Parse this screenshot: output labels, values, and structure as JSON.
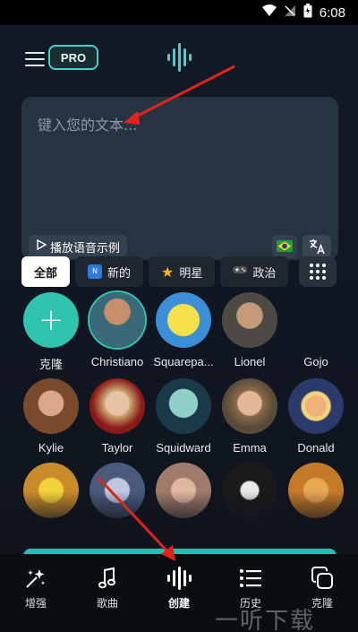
{
  "status_bar": {
    "time": "6:08"
  },
  "header": {
    "pro_label": "PRO"
  },
  "text_input": {
    "placeholder": "键入您的文本...",
    "sample_button": "播放语音示例"
  },
  "categories": [
    {
      "label": "全部",
      "active": true,
      "icon": ""
    },
    {
      "label": "新的",
      "active": false,
      "icon": "new-badge-icon"
    },
    {
      "label": "明星",
      "active": false,
      "icon": "star-icon"
    },
    {
      "label": "政治",
      "active": false,
      "icon": "game-controller-icon"
    }
  ],
  "voices": [
    {
      "name": "克隆",
      "type": "add"
    },
    {
      "name": "Christiano",
      "color": "#3a6a7a"
    },
    {
      "name": "Squarepa...",
      "color": "#f2d43a"
    },
    {
      "name": "Lionel",
      "color": "#4d4a45"
    },
    {
      "name": "Gojo",
      "color": ""
    },
    {
      "name": "Kylie",
      "color": "#8a5a3c"
    },
    {
      "name": "Taylor",
      "color": "#a3201e"
    },
    {
      "name": "Squidward",
      "color": "#5bb8b0"
    },
    {
      "name": "Emma",
      "color": "#b08a6a"
    },
    {
      "name": "Donald",
      "color": "#5a7db5"
    },
    {
      "name": "",
      "color": "#c98a2a"
    },
    {
      "name": "",
      "color": "#4a5a7a"
    },
    {
      "name": "",
      "color": "#a07a6a"
    },
    {
      "name": "",
      "color": "#1a1a1a"
    },
    {
      "name": "",
      "color": "#c57a2a"
    }
  ],
  "bottom_nav": [
    {
      "label": "增强",
      "icon": "sparkle-icon"
    },
    {
      "label": "歌曲",
      "icon": "music-note-icon"
    },
    {
      "label": "创建",
      "icon": "waveform-icon"
    },
    {
      "label": "历史",
      "icon": "list-icon"
    },
    {
      "label": "克隆",
      "icon": "copy-icon"
    }
  ],
  "watermark": "一听下载",
  "colors": {
    "accent": "#2ec4b0",
    "pro_border": "#3fd4c6",
    "arrow": "#e0241c"
  }
}
